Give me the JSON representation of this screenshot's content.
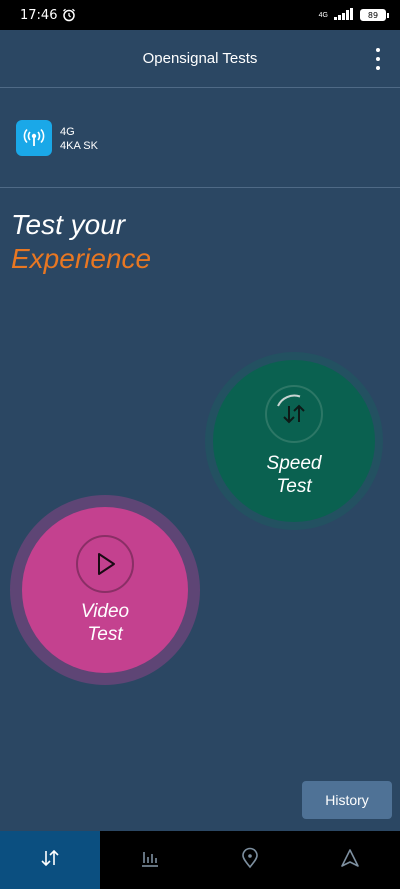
{
  "status_bar": {
    "time": "17:46",
    "network_type": "4G",
    "battery": "89"
  },
  "app_bar": {
    "title": "Opensignal Tests"
  },
  "network": {
    "technology": "4G",
    "operator": "4KA SK"
  },
  "headline": {
    "line1": "Test your",
    "line2": "Experience"
  },
  "speed_test": {
    "line1": "Speed",
    "line2": "Test"
  },
  "video_test": {
    "line1": "Video",
    "line2": "Test"
  },
  "history_button": "History",
  "bottom_nav": {
    "items": [
      {
        "icon": "tests-arrows-icon",
        "active": true
      },
      {
        "icon": "stats-chart-icon",
        "active": false
      },
      {
        "icon": "map-pin-icon",
        "active": false
      },
      {
        "icon": "navigation-arrow-icon",
        "active": false
      }
    ]
  },
  "colors": {
    "background": "#2b4763",
    "accent_orange": "#e87722",
    "speed_green": "#0a6150",
    "video_pink": "#c4418f",
    "network_blue": "#1aa8e8"
  }
}
